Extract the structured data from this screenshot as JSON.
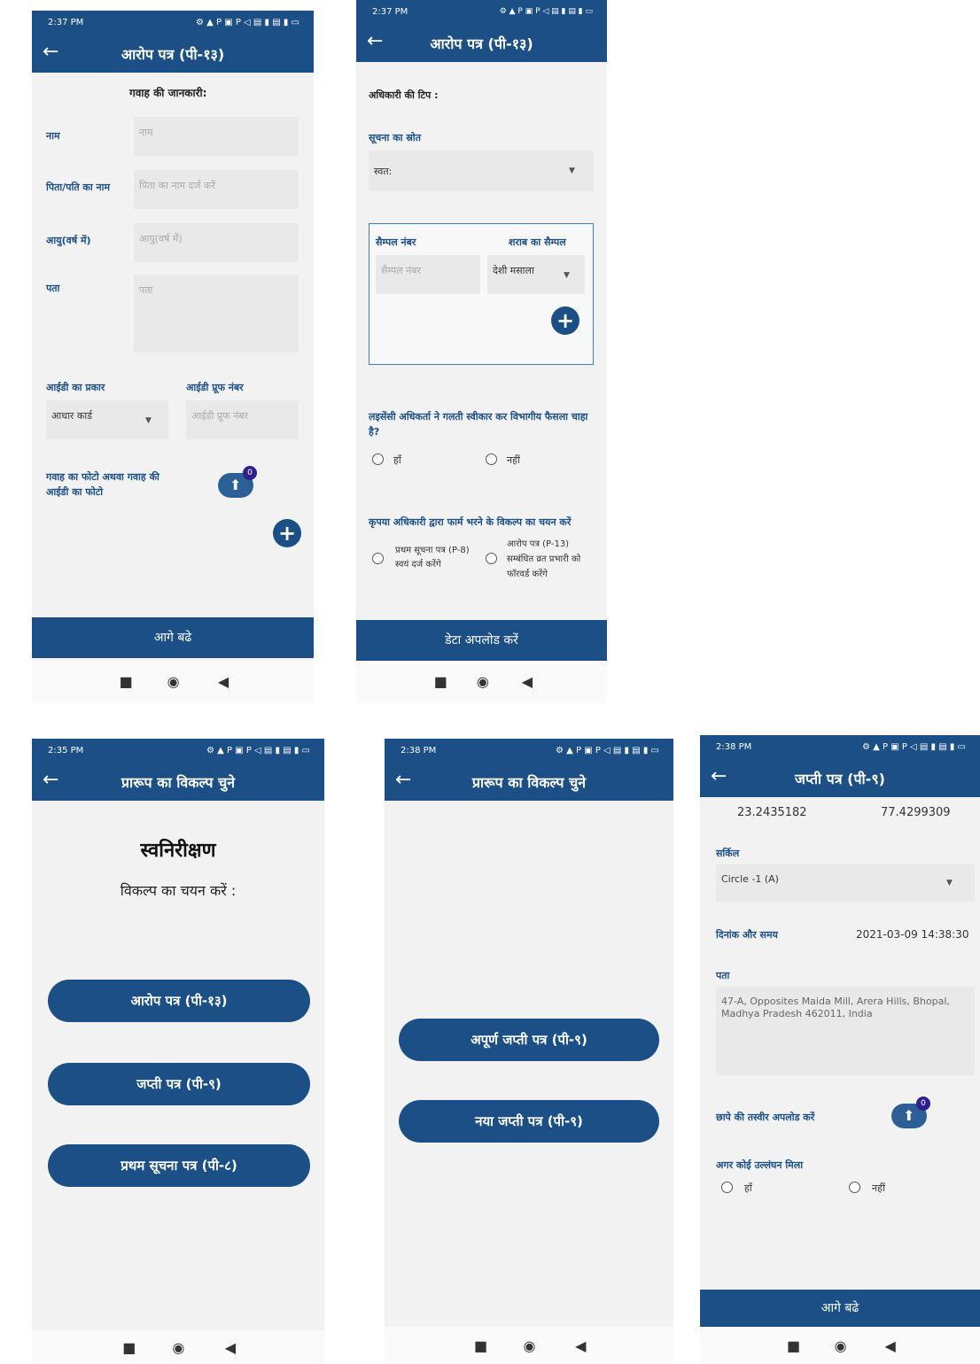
{
  "status": {
    "time_1": "2:37 PM",
    "time_2": "2:37 PM",
    "time_3": "2:35 PM",
    "time_4": "2:38 PM",
    "time_5": "2:38 PM",
    "icons": "⚙ ▲ P ▣ P   ◁ ▤ ▮ ▤ ▮ ▭"
  },
  "nav": {
    "stop": "■",
    "home": "◉",
    "back": "◀"
  },
  "s1": {
    "title": "आरोप पत्र (पी-१३)",
    "section": "गवाह की जानकारी:",
    "name_label": "नाम",
    "name_ph": "नाम",
    "father_label": "पिता/पति का नाम",
    "father_ph": "पिता का नाम दर्ज करें",
    "age_label": "आयु(वर्ष में)",
    "age_ph": "आयु(वर्ष में)",
    "addr_label": "पता",
    "addr_ph": "पता",
    "idtype_label": "आईडी का प्रकार",
    "idtype_value": "आधार कार्ड",
    "idno_label": "आईडी प्रूफ नंबर",
    "idno_ph": "आईडी प्रूफ नंबर",
    "photo_label": "गवाह का फोटो अथवा गवाह की आईडी का फोटो",
    "badge": "0",
    "next": "आगे बढे"
  },
  "s2": {
    "title": "आरोप पत्र (पी-१३)",
    "remark_label": "अधिकारी की टिप :",
    "source_label": "सूचना का स्रोत",
    "source_value": "स्वत:",
    "sample_no_label": "सैम्पल नंबर",
    "sample_no_ph": "सैम्पल नंबर",
    "liquor_label": "शराब का सैम्पल",
    "liquor_value": "देशी मसाला",
    "license_q": "लइसेंसी अधिकर्ता ने गलती स्वीकार कर विभागीय फैसला चाहा है?",
    "yes": "हाँ",
    "no": "नहीं",
    "choose_q": "कृपया अधिकारी द्वारा फार्म भरने के विकल्प का चयन करें",
    "opt1": "प्रथम सूचना पत्र (P-8) स्वयं दर्ज करेंगे",
    "opt2": "आरोप पत्र (P-13) सम्बंधित व्रत प्रभारी को फॉरवर्ड करेंगे",
    "upload": "डेटा अपलोड करें"
  },
  "s3": {
    "title": "प्रारूप का विकल्प चुने",
    "heading": "स्वनिरीक्षण",
    "sub": "विकल्प का चयन करें :",
    "b1": "आरोप पत्र (पी-१३)",
    "b2": "जप्ती पत्र (पी-९)",
    "b3": "प्रथम सूचना पत्र (पी-८)"
  },
  "s4": {
    "title": "प्रारूप का विकल्प चुने",
    "b1": "अपूर्ण जप्ती पत्र (पी-९)",
    "b2": "नया जप्ती पत्र (पी-९)"
  },
  "s5": {
    "title": "जप्ती पत्र (पी-९)",
    "lat": "23.2435182",
    "lng": "77.4299309",
    "circle_label": "सर्किल",
    "circle_value": "Circle -1 (A)",
    "dt_label": "दिनांक और समय",
    "dt_value": "2021-03-09 14:38:30",
    "addr_label": "पता",
    "addr_value": "47-A, Opposites Maida Mill, Arera Hills, Bhopal, Madhya Pradesh 462011, India",
    "photo_label": "छापे की तस्वीर अपलोड करें",
    "badge": "0",
    "violation_label": "अगर कोई उल्लंघन मिला",
    "yes": "हाँ",
    "no": "नहीं",
    "next": "आगे बढे"
  }
}
